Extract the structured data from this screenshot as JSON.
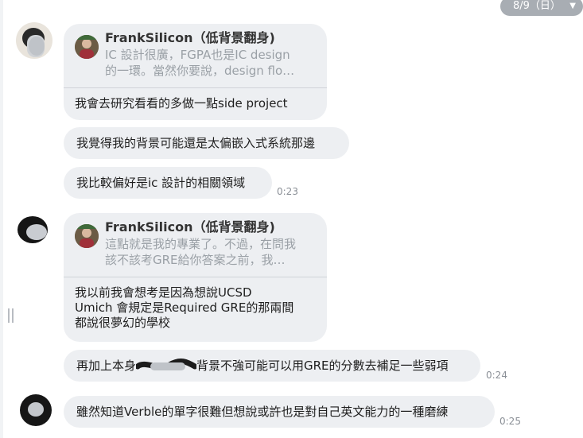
{
  "date_separator": {
    "label": "8/9（日）",
    "caret": "▼"
  },
  "messages": [
    {
      "reply": {
        "name": "FrankSilicon（低背景翻身)",
        "quote_line1": "IC 設計很廣，FGPA也是IC design",
        "quote_line2": "的一環。當然你要說，design flo…"
      },
      "text": "我會去研究看看的多做一點side project"
    },
    {
      "text": "我覺得我的背景可能還是太偏嵌入式系統那邊"
    },
    {
      "text": "我比較偏好是ic 設計的相關領域",
      "time": "0:23"
    },
    {
      "reply": {
        "name": "FrankSilicon（低背景翻身)",
        "quote_line1": "這點就是我的專業了。不過，在問我",
        "quote_line2": "該不該考GRE給你答案之前，我…"
      },
      "lines": [
        "我以前我會想考是因為想說UCSD",
        "Umich 會規定是Required GRE的那兩間",
        "都說很夢幻的學校"
      ]
    },
    {
      "text_start": "再加上本身",
      "text_end": "背景不強可能可以用GRE的分數去補足一些弱項",
      "time": "0:24"
    },
    {
      "text": "雖然知道Verble的單字很難但想說或許也是對自己英文能力的一種磨練",
      "time": "0:25"
    }
  ]
}
